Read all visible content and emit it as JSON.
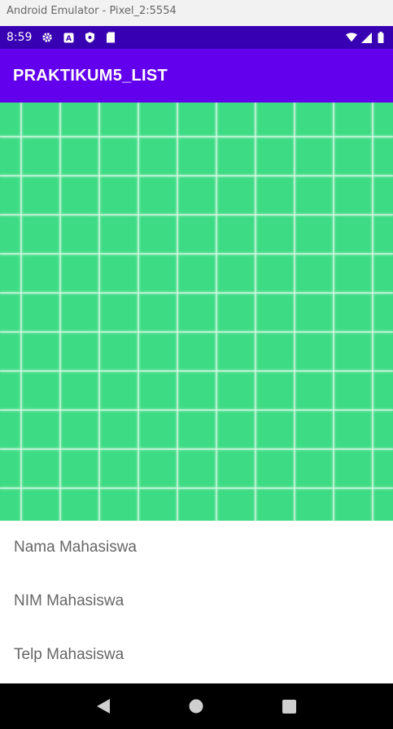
{
  "window": {
    "title": "Android Emulator - Pixel_2:5554"
  },
  "status_bar": {
    "time": "8:59",
    "left_icons": [
      "settings-icon",
      "a-icon",
      "shield-icon",
      "sd-card-icon"
    ],
    "right_icons": [
      "wifi-icon",
      "signal-icon",
      "battery-icon"
    ]
  },
  "app_bar": {
    "title": "PRAKTIKUM5_LIST"
  },
  "image": {
    "background": "#3ddc84",
    "description_icon": "grid-icon"
  },
  "list": {
    "items": [
      {
        "label": "Nama Mahasiswa"
      },
      {
        "label": "NIM Mahasiswa"
      },
      {
        "label": "Telp Mahasiswa"
      }
    ]
  },
  "nav_bar": {
    "buttons": [
      "back-icon",
      "home-icon",
      "recents-icon"
    ]
  },
  "colors": {
    "status_bar": "#3700b3",
    "app_bar": "#6200ee",
    "image_bg": "#3ddc84",
    "list_text": "#666666"
  }
}
